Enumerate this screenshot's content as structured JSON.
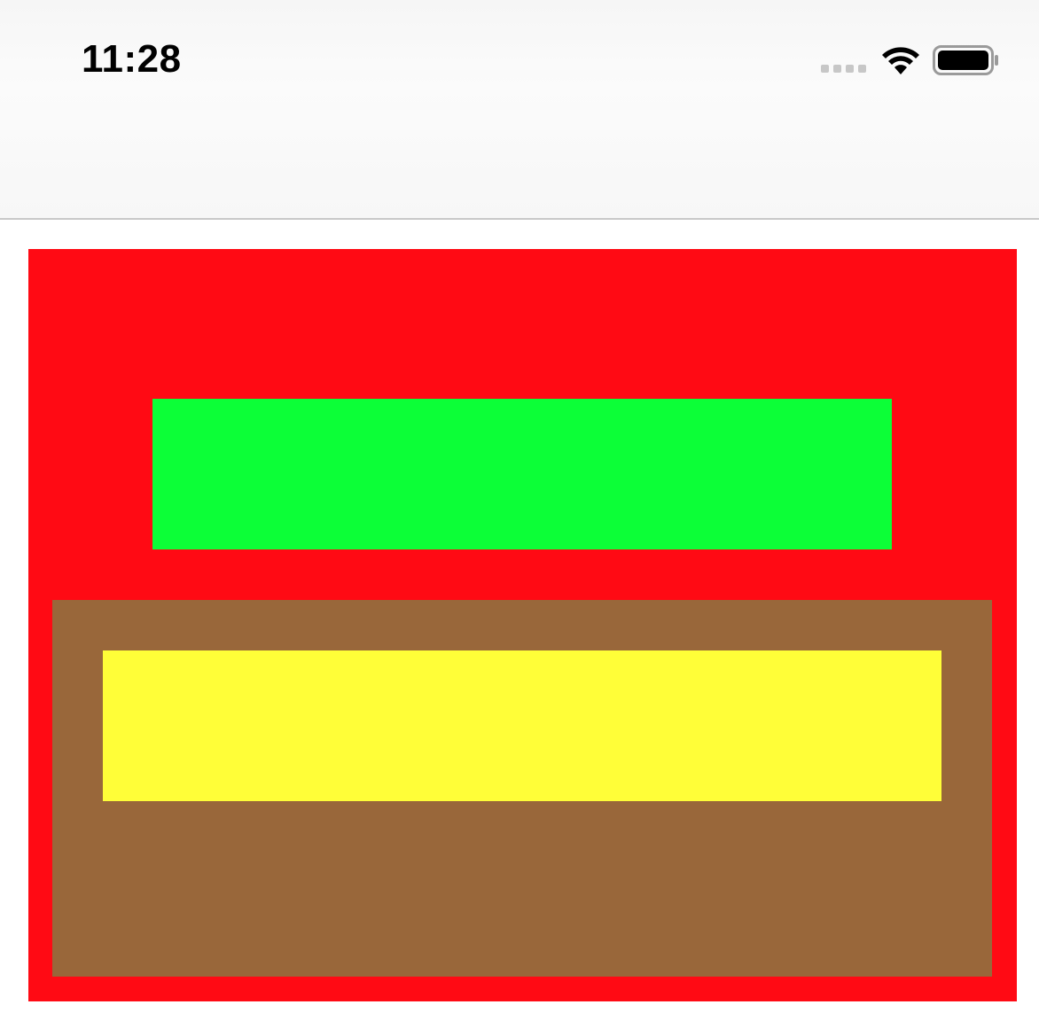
{
  "status_bar": {
    "time": "11:28",
    "icons": [
      "cellular-signal-icon",
      "wifi-icon",
      "battery-icon"
    ]
  },
  "colors": {
    "red_view": "#ff0a14",
    "green_view": "#0cff37",
    "brown_view": "#99673a",
    "yellow_view": "#fffe38",
    "nav_background": "#f7f7f7",
    "separator": "#c8c8c8"
  }
}
